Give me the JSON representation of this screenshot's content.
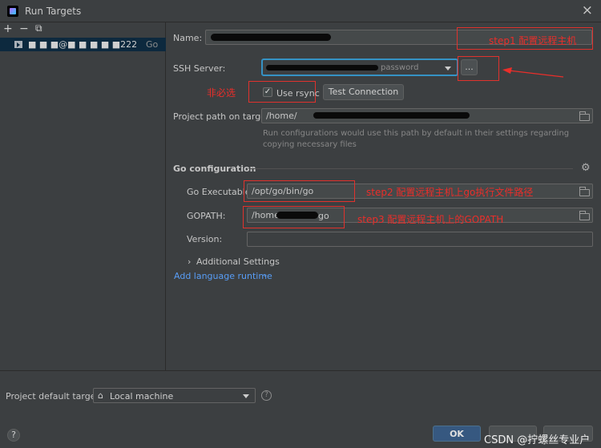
{
  "window": {
    "title": "Run Targets",
    "close_glyph": "×"
  },
  "sidebar": {
    "toolbar": {
      "add": "+",
      "remove": "−",
      "copy": "⧉"
    },
    "targets": [
      {
        "name": "■ ■ ■@■ ■ ■ ■ ■222",
        "type": "Go"
      }
    ]
  },
  "form": {
    "name_label": "Name:",
    "name_value": "",
    "ssh_label": "SSH Server:",
    "ssh_value": "password",
    "browse_label": "...",
    "rsync_label": "Use rsync",
    "rsync_checked": true,
    "test_button": "Test Connection",
    "path_label": "Project path on target:",
    "path_value": "/home/",
    "path_hint": "Run configurations would use this path by default in their settings regarding copying necessary files",
    "go_section": "Go configuration",
    "go_exec_label": "Go Executable:",
    "go_exec_value": "/opt/go/bin/go",
    "gopath_label": "GOPATH:",
    "gopath_value": "/home/",
    "gopath_suffix": "go",
    "version_label": "Version:",
    "version_value": "",
    "additional": "Additional Settings",
    "add_runtime": "Add language runtime"
  },
  "annotations": {
    "step1": "step1 配置远程主机",
    "optional": "非必选",
    "step2": "step2 配置远程主机上go执行文件路径",
    "step3": "step3 配置远程主机上的GOPATH"
  },
  "footer": {
    "default_label": "Project default target:",
    "default_value": "Local machine",
    "ok": "OK",
    "help": "?",
    "watermark": "CSDN @拧螺丝专业户"
  },
  "colors": {
    "accent": "#3592c4",
    "annotation": "#ea2e2a",
    "ok_button": "#365880",
    "link": "#589df6"
  }
}
